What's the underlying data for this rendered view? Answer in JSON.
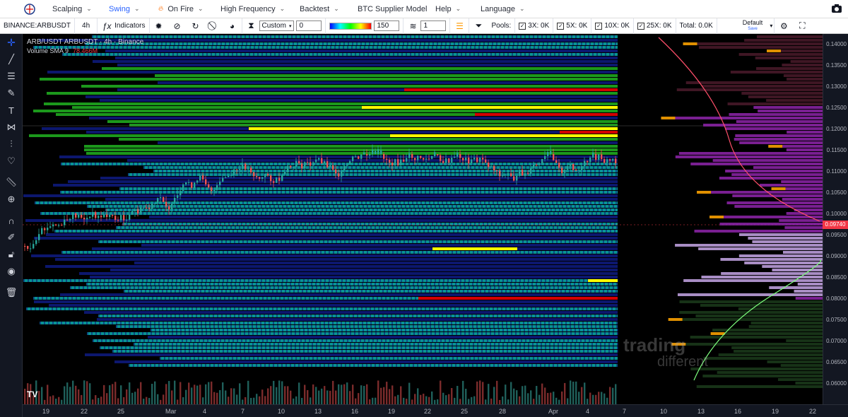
{
  "nav": {
    "items": [
      {
        "label": "Scalping",
        "active": false
      },
      {
        "label": "Swing",
        "active": true
      },
      {
        "label": "On Fire",
        "active": false
      },
      {
        "label": "High Frequency",
        "active": false
      },
      {
        "label": "Backtest",
        "active": false
      },
      {
        "label": "BTC Supplier Model",
        "active": false
      },
      {
        "label": "Help",
        "active": false
      },
      {
        "label": "Language",
        "active": false
      }
    ]
  },
  "toolbar": {
    "symbol": "BINANCE:ARBUSDT",
    "interval": "4h",
    "indicators_label": "Indicators",
    "range_select": "Custom",
    "range_value": "0",
    "gradient_value": "150",
    "layers_value": "1",
    "pools_label": "Pools:",
    "pools": [
      {
        "label": "3X: 0K",
        "checked": true
      },
      {
        "label": "5X: 0K",
        "checked": true
      },
      {
        "label": "10X: 0K",
        "checked": true
      },
      {
        "label": "25X: 0K",
        "checked": true
      }
    ],
    "total": "Total: 0.0K",
    "layout_name": "Default",
    "layout_sub": "Save"
  },
  "chart": {
    "title": "ARB/USDT ARBUSDT · 4h · Binance",
    "volume_label": "Volume SMA 9",
    "volume_value": "78.466M",
    "current_price": "0.09740",
    "watermark_main": "trading",
    "watermark_sub": "different",
    "tv_logo": "TV",
    "colors": {
      "up": "#26a69a",
      "down": "#ef5350",
      "heat_low": "#0d1a7a",
      "heat_mid": "#00a0a0",
      "heat_high": "#ffff00",
      "heat_max": "#d50000"
    }
  },
  "price_axis": {
    "ticks": [
      "0.14000",
      "0.13500",
      "0.13000",
      "0.12500",
      "0.12000",
      "0.11500",
      "0.11000",
      "0.10500",
      "0.10000",
      "0.09500",
      "0.09000",
      "0.08500",
      "0.08000",
      "0.07500",
      "0.07000",
      "0.06500",
      "0.06000"
    ]
  },
  "time_axis": {
    "ticks": [
      "19",
      "22",
      "25",
      "Mar",
      "4",
      "7",
      "10",
      "13",
      "16",
      "19",
      "22",
      "25",
      "28",
      "Apr",
      "4",
      "7",
      "10",
      "13",
      "16",
      "19",
      "22"
    ]
  }
}
